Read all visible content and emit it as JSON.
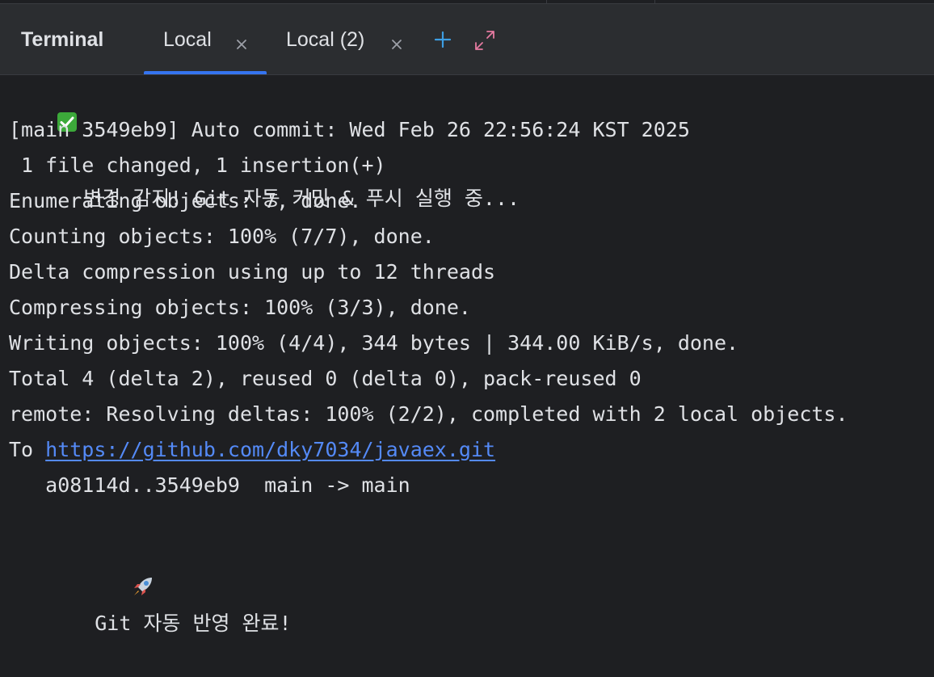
{
  "header": {
    "title": "Terminal",
    "tabs": [
      {
        "label": "Local",
        "active": true
      },
      {
        "label": "Local (2)",
        "active": false
      }
    ],
    "new_tab_icon": "plus-icon",
    "maximize_icon": "expand-icon"
  },
  "colors": {
    "accent": "#3574f0",
    "link": "#548af7",
    "text": "#dfe1e5",
    "background": "#1e1f22",
    "header_bg": "#2b2d30",
    "check": "#3ca93a"
  },
  "terminal": {
    "line1": "변경 감지! Git 자동 커밋 & 푸시 실행 중...",
    "line2": "[main 3549eb9] Auto commit: Wed Feb 26 22:56:24 KST 2025",
    "line3": " 1 file changed, 1 insertion(+)",
    "line4": "Enumerating objects: 7, done.",
    "line5": "Counting objects: 100% (7/7), done.",
    "line6": "Delta compression using up to 12 threads",
    "line7": "Compressing objects: 100% (3/3), done.",
    "line8": "Writing objects: 100% (4/4), 344 bytes | 344.00 KiB/s, done.",
    "line9": "Total 4 (delta 2), reused 0 (delta 0), pack-reused 0",
    "line10": "remote: Resolving deltas: 100% (2/2), completed with 2 local objects.",
    "line11_prefix": "To ",
    "line11_link": "https://github.com/dky7034/javaex.git",
    "line12": "   a08114d..3549eb9  main -> main",
    "line13": "Git 자동 반영 완료!"
  }
}
